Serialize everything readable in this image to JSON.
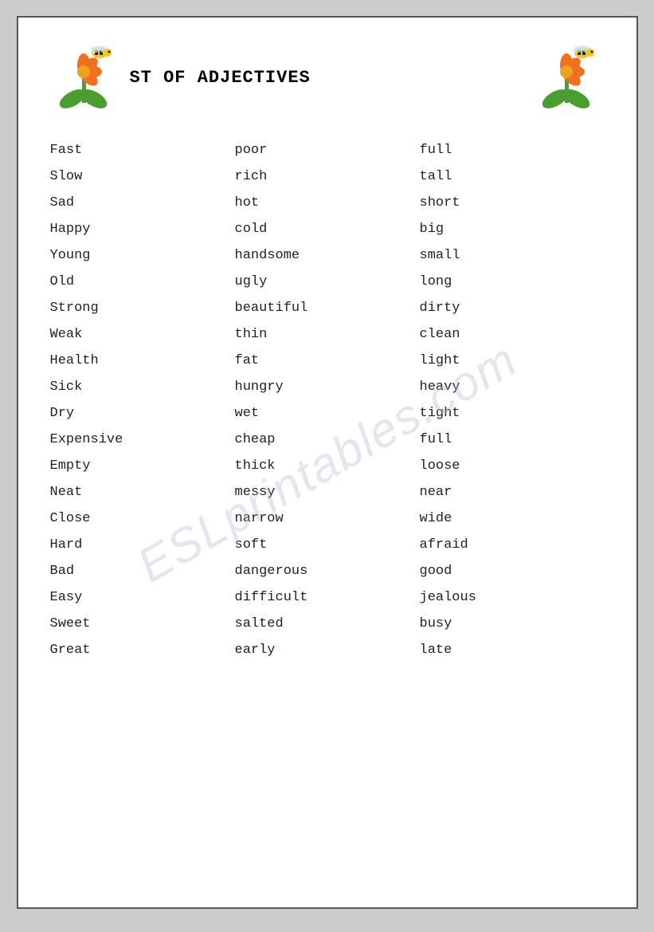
{
  "header": {
    "title": "ST OF ADJECTIVES"
  },
  "watermark": "ESLprintables.com",
  "words": [
    {
      "col1": "Fast",
      "col2": "poor",
      "col3": "full"
    },
    {
      "col1": "Slow",
      "col2": "rich",
      "col3": "tall"
    },
    {
      "col1": "Sad",
      "col2": "hot",
      "col3": "short"
    },
    {
      "col1": "Happy",
      "col2": "cold",
      "col3": "big"
    },
    {
      "col1": "Young",
      "col2": "handsome",
      "col3": "small"
    },
    {
      "col1": "Old",
      "col2": "ugly",
      "col3": "long"
    },
    {
      "col1": "Strong",
      "col2": "beautiful",
      "col3": "dirty"
    },
    {
      "col1": "Weak",
      "col2": "thin",
      "col3": "clean"
    },
    {
      "col1": "Health",
      "col2": "fat",
      "col3": "light"
    },
    {
      "col1": "Sick",
      "col2": "hungry",
      "col3": "heavy"
    },
    {
      "col1": "Dry",
      "col2": "wet",
      "col3": "tight"
    },
    {
      "col1": "Expensive",
      "col2": "cheap",
      "col3": "full"
    },
    {
      "col1": "Empty",
      "col2": "thick",
      "col3": "loose"
    },
    {
      "col1": "Neat",
      "col2": "messy",
      "col3": "near"
    },
    {
      "col1": "Close",
      "col2": "narrow",
      "col3": "wide"
    },
    {
      "col1": "Hard",
      "col2": "soft",
      "col3": "afraid"
    },
    {
      "col1": "Bad",
      "col2": "dangerous",
      "col3": "good"
    },
    {
      "col1": "Easy",
      "col2": "difficult",
      "col3": "jealous"
    },
    {
      "col1": "Sweet",
      "col2": "salted",
      "col3": "busy"
    },
    {
      "col1": "Great",
      "col2": "early",
      "col3": "late"
    }
  ]
}
